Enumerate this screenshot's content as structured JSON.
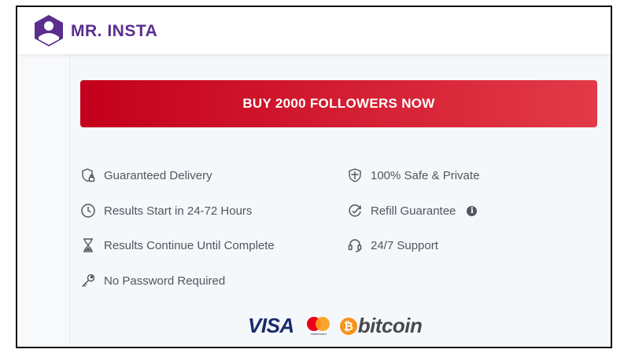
{
  "brand": {
    "name": "MR. INSTA",
    "primary_color": "#5b2d8e",
    "logo_icon": "shield-user-icon"
  },
  "cta": {
    "label": "BUY 2000 FOLLOWERS NOW",
    "gradient_start": "#c4001b",
    "gradient_end": "#e23a48"
  },
  "features": {
    "left": [
      {
        "icon": "shield-lock-icon",
        "label": "Guaranteed Delivery"
      },
      {
        "icon": "clock-icon",
        "label": "Results Start in 24-72 Hours"
      },
      {
        "icon": "hourglass-icon",
        "label": "Results Continue Until Complete"
      },
      {
        "icon": "key-icon",
        "label": "No Password Required"
      }
    ],
    "right": [
      {
        "icon": "shield-icon",
        "label": "100% Safe & Private"
      },
      {
        "icon": "refresh-check-icon",
        "label": "Refill Guarantee",
        "info": "i"
      },
      {
        "icon": "headset-icon",
        "label": "24/7 Support"
      }
    ]
  },
  "payments": {
    "visa": "VISA",
    "mastercard_caption": "mastercard",
    "bitcoin_symbol": "₿",
    "bitcoin": "bitcoin"
  }
}
